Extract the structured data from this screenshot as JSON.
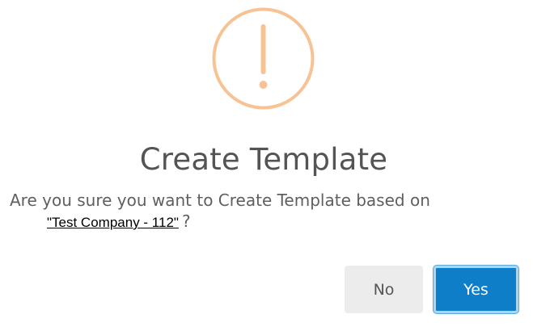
{
  "dialog": {
    "icon": "exclamation-circle-icon",
    "icon_color": "#f7c394",
    "title": "Create Template",
    "message": "Are you sure you want to Create Template based on",
    "target_name": "\"Test Company - 112\"",
    "question_mark": "?",
    "buttons": {
      "no_label": "No",
      "yes_label": "Yes"
    },
    "colors": {
      "primary_button": "#0f7ec8",
      "secondary_button": "#ececec"
    }
  }
}
